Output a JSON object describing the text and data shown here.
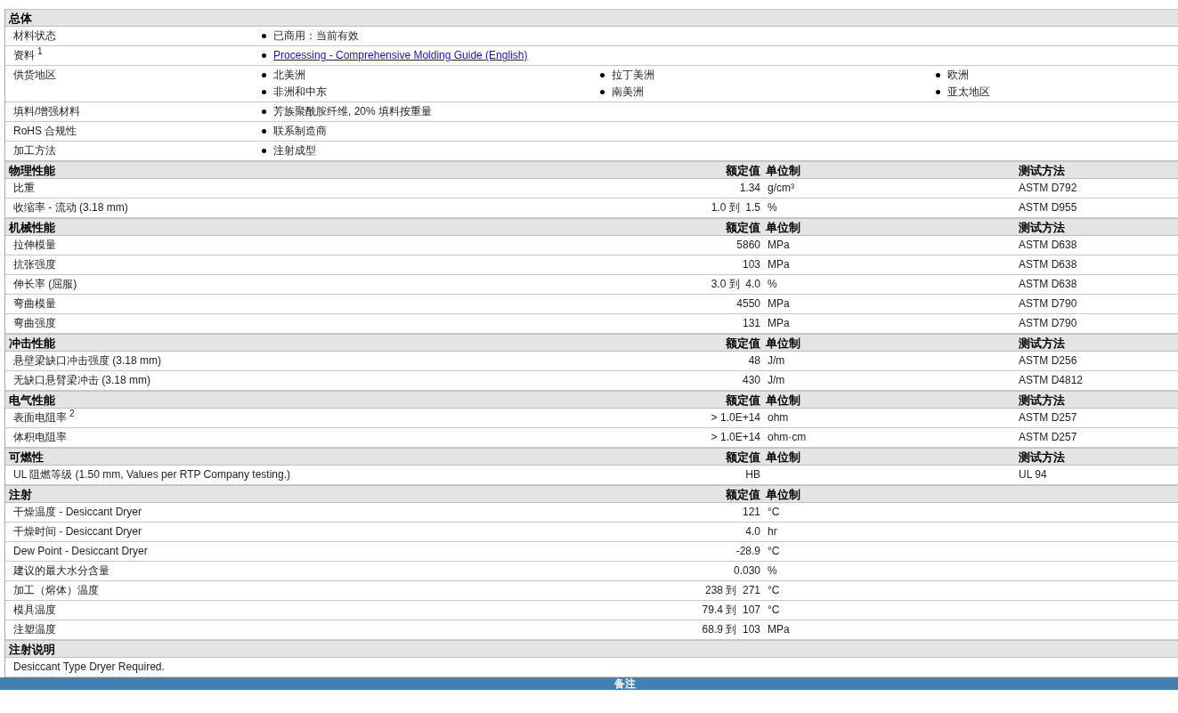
{
  "sections": [
    {
      "title": "总体",
      "kind": "general",
      "rows": [
        {
          "label": "材料状态",
          "items": [
            {
              "kind": "text",
              "text": "已商用：当前有效"
            }
          ]
        },
        {
          "label": "资料",
          "sup": "1",
          "items": [
            {
              "kind": "link",
              "text": "Processing - Comprehensive Molding Guide (English)"
            }
          ]
        },
        {
          "label": "供货地区",
          "items": [
            {
              "kind": "text",
              "text": "北美洲"
            },
            {
              "kind": "text",
              "text": "拉丁美洲"
            },
            {
              "kind": "text",
              "text": "欧洲"
            },
            {
              "kind": "text",
              "text": "非洲和中东"
            },
            {
              "kind": "text",
              "text": "南美洲"
            },
            {
              "kind": "text",
              "text": "亚太地区"
            }
          ]
        },
        {
          "label": "填料/增强材料",
          "items": [
            {
              "kind": "text",
              "text": "芳族聚酰胺纤维, 20% 填料按重量"
            }
          ]
        },
        {
          "label": "RoHS 合规性",
          "items": [
            {
              "kind": "text",
              "text": "联系制造商"
            }
          ]
        },
        {
          "label": "加工方法",
          "items": [
            {
              "kind": "text",
              "text": "注射成型"
            }
          ]
        }
      ]
    },
    {
      "title": "物理性能",
      "kind": "props",
      "value_header": "额定值",
      "unit_header": "单位制",
      "method_header": "测试方法",
      "rows": [
        {
          "label": "比重",
          "value": "1.34",
          "unit": "g/cm³",
          "method": "ASTM D792"
        },
        {
          "label": "收缩率  - 流动  (3.18 mm)",
          "value": "1.0 到  1.5",
          "unit": "%",
          "method": "ASTM D955"
        }
      ]
    },
    {
      "title": "机械性能",
      "kind": "props",
      "value_header": "额定值",
      "unit_header": "单位制",
      "method_header": "测试方法",
      "rows": [
        {
          "label": "拉伸模量",
          "value": "5860",
          "unit": "MPa",
          "method": "ASTM D638"
        },
        {
          "label": "抗张强度",
          "value": "103",
          "unit": "MPa",
          "method": "ASTM D638"
        },
        {
          "label": "伸长率  (屈服)",
          "value": "3.0 到  4.0",
          "unit": "%",
          "method": "ASTM D638"
        },
        {
          "label": "弯曲模量",
          "value": "4550",
          "unit": "MPa",
          "method": "ASTM D790"
        },
        {
          "label": "弯曲强度",
          "value": "131",
          "unit": "MPa",
          "method": "ASTM D790"
        }
      ]
    },
    {
      "title": "冲击性能",
      "kind": "props",
      "value_header": "额定值",
      "unit_header": "单位制",
      "method_header": "测试方法",
      "rows": [
        {
          "label": "悬壁梁缺口冲击强度  (3.18 mm)",
          "value": "48",
          "unit": "J/m",
          "method": "ASTM D256"
        },
        {
          "label": "无缺口悬臂梁冲击  (3.18 mm)",
          "value": "430",
          "unit": "J/m",
          "method": "ASTM D4812"
        }
      ]
    },
    {
      "title": "电气性能",
      "kind": "props",
      "value_header": "额定值",
      "unit_header": "单位制",
      "method_header": "测试方法",
      "rows": [
        {
          "label": "表面电阻率",
          "sup": "2",
          "value": "> 1.0E+14",
          "unit": "ohm",
          "method": "ASTM D257"
        },
        {
          "label": "体积电阻率",
          "value": "> 1.0E+14",
          "unit": "ohm·cm",
          "method": "ASTM D257"
        }
      ]
    },
    {
      "title": "可燃性",
      "kind": "props",
      "value_header": "额定值",
      "unit_header": "单位制",
      "method_header": "测试方法",
      "rows": [
        {
          "label": "UL 阻燃等级  (1.50 mm, Values per RTP Company testing.)",
          "value": "HB",
          "method": "UL 94"
        }
      ]
    },
    {
      "title": "注射",
      "kind": "props",
      "value_header": "额定值",
      "unit_header": "单位制",
      "rows": [
        {
          "label": "干燥温度  - Desiccant Dryer",
          "value": "121",
          "unit": "°C"
        },
        {
          "label": "干燥时间  - Desiccant Dryer",
          "value": "4.0",
          "unit": "hr"
        },
        {
          "label": "Dew Point - Desiccant Dryer",
          "value": "-28.9",
          "unit": "°C"
        },
        {
          "label": "建议的最大水分含量",
          "value": "0.030",
          "unit": "%"
        },
        {
          "label": "加工（熔体）温度",
          "value": "238 到  271",
          "unit": "°C"
        },
        {
          "label": "模具温度",
          "value": "79.4 到  107",
          "unit": "°C"
        },
        {
          "label": "注塑温度",
          "value": "68.9 到  103",
          "unit": "MPa"
        }
      ]
    },
    {
      "title": "注射说明",
      "kind": "note",
      "rows": [
        {
          "text": "Desiccant Type Dryer Required."
        }
      ]
    }
  ],
  "footer": {
    "title": "备注"
  }
}
